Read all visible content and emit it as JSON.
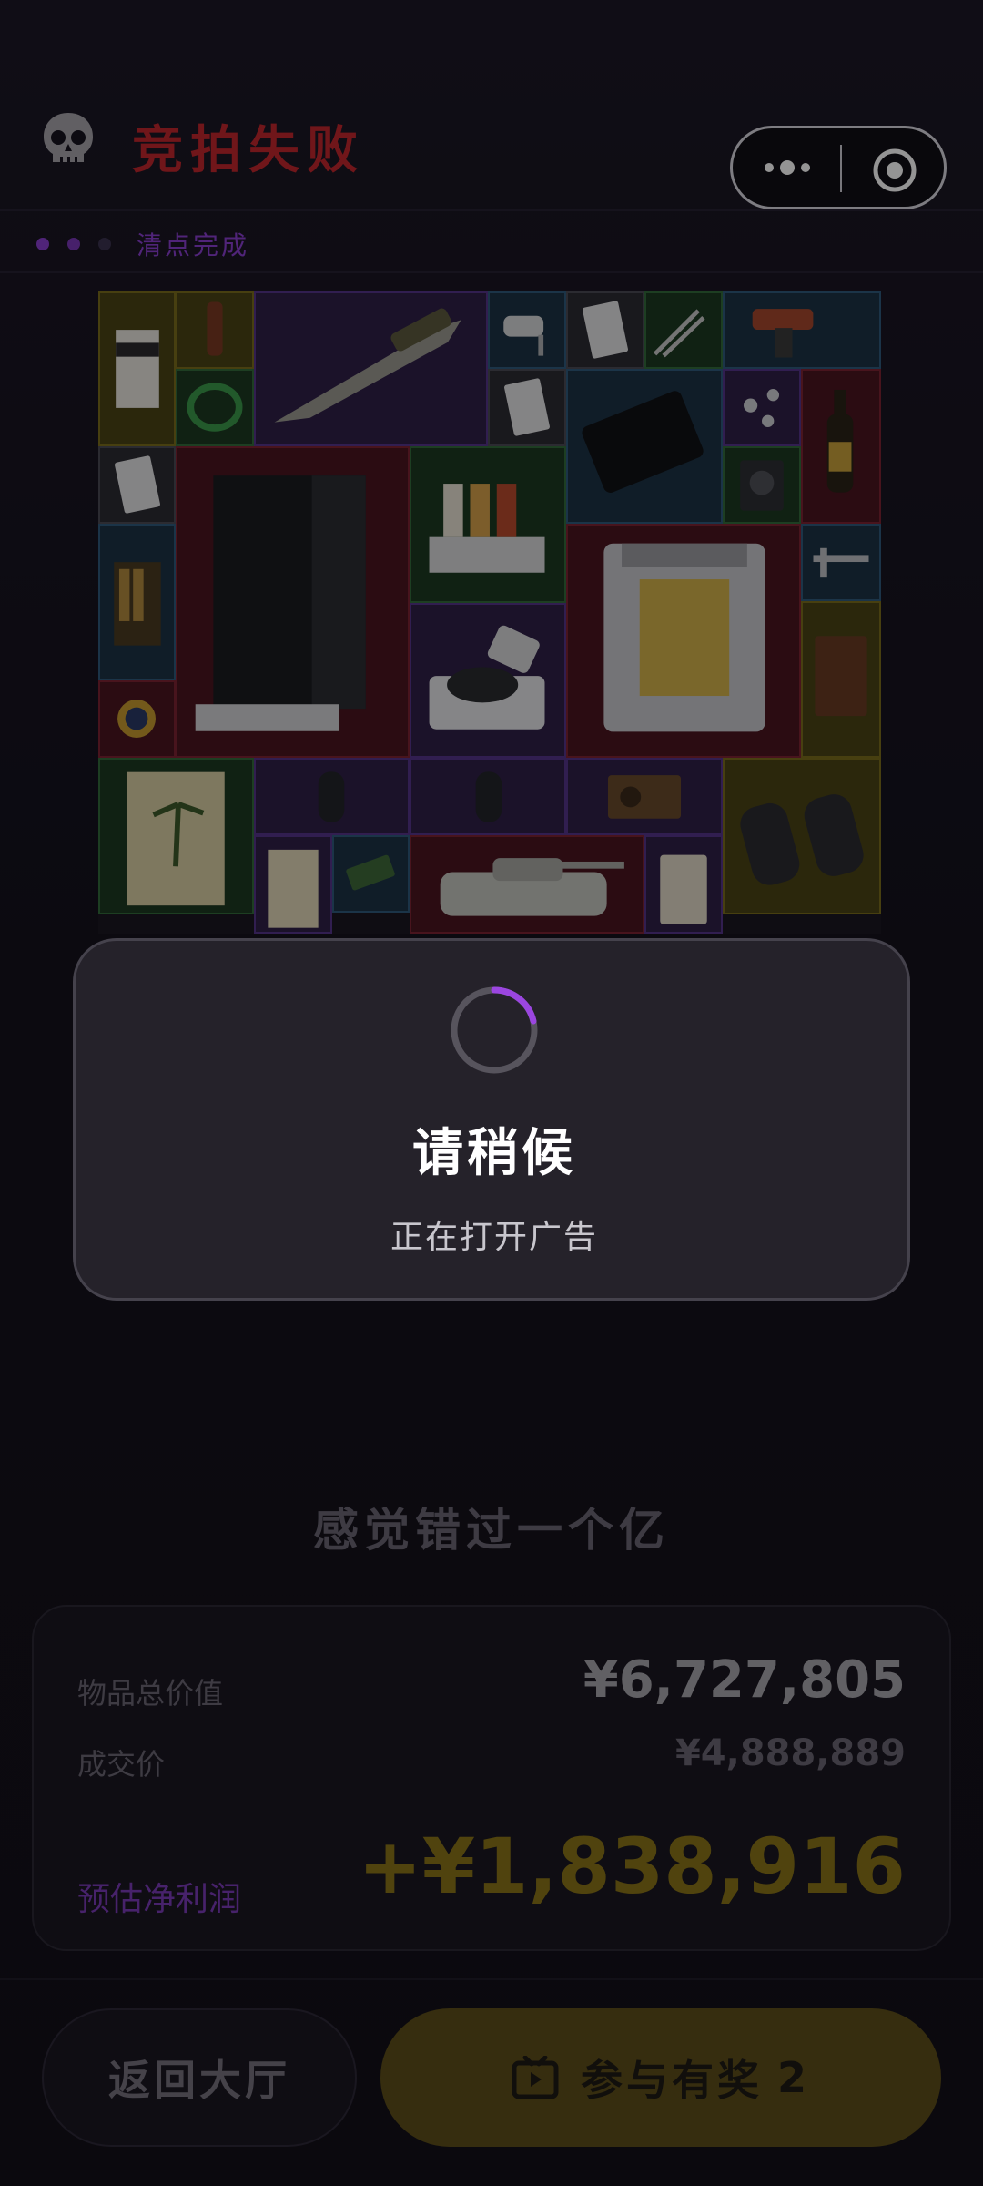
{
  "header": {
    "title": "竞拍失败",
    "status_text": "清点完成",
    "skull_icon": "skull-icon",
    "title_color": "#c1262d"
  },
  "capsule": {
    "more_icon": "more-dots-icon",
    "close_icon": "target-circle-icon"
  },
  "grid_items": [
    "barista-box",
    "bottle-small",
    "combat-knife",
    "security-camera",
    "card",
    "pliers",
    "power-drill",
    "green-cable",
    "card",
    "tablet",
    "molecule-model",
    "champagne-bottle",
    "card",
    "server-rack",
    "spice-rack",
    "power-supply",
    "reactor-core",
    "caliper",
    "ammo-box",
    "centrifuge",
    "leather-journal",
    "gold-watch",
    "travel-poster",
    "fan",
    "fan",
    "radio",
    "binoculars",
    "book",
    "sd-card",
    "tank-model",
    "coffee-bag"
  ],
  "dialog": {
    "title": "请稍候",
    "subtitle": "正在打开广告",
    "spinner_color": "#9b46e0"
  },
  "result": {
    "slogan": "感觉错过一个亿",
    "total_label": "物品总价值",
    "total_value": "¥6,727,805",
    "price_label": "成交价",
    "price_value": "¥4,888,889",
    "net_label": "预估净利润",
    "net_value": "+¥1,838,916"
  },
  "buttons": {
    "back": "返回大厅",
    "join": "参与有奖",
    "join_count": "2",
    "join_icon": "tv-icon"
  }
}
